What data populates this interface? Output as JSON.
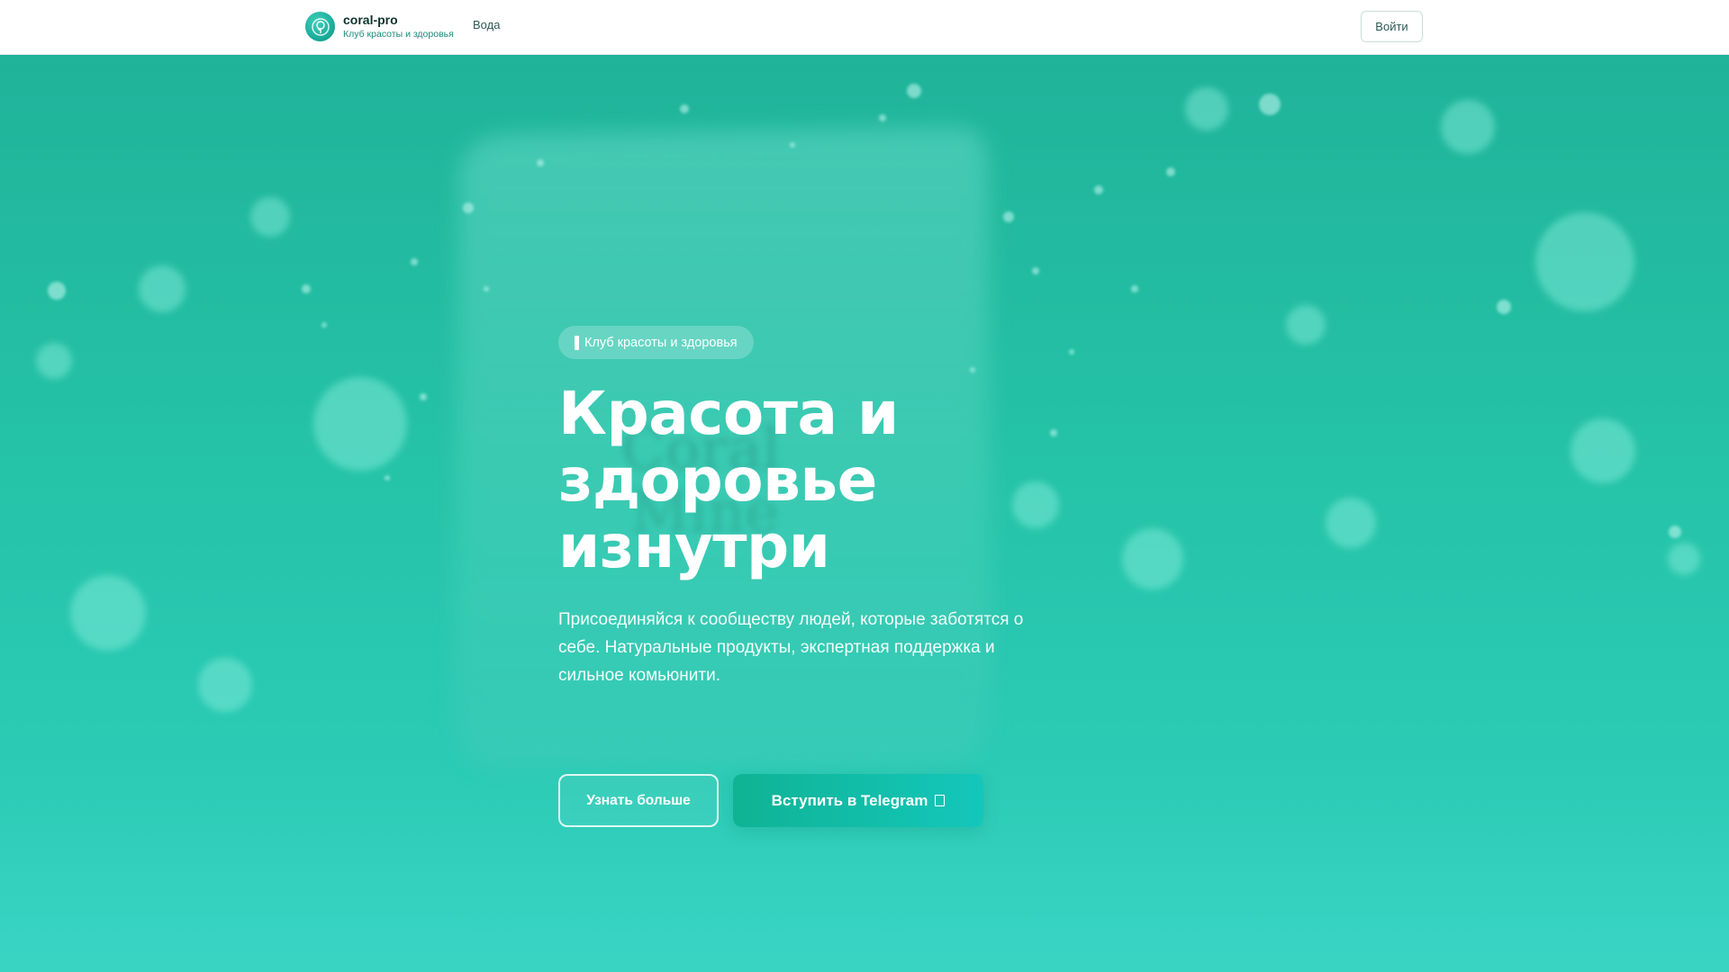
{
  "header": {
    "brand_name": "coral-pro",
    "brand_subtitle": "Клуб красоты и здоровья",
    "nav": [
      {
        "label": "Вода"
      }
    ],
    "login_label": "Войти"
  },
  "hero": {
    "badge": "Клуб красоты и здоровья",
    "title_lines": [
      "Красота и",
      "здоровье",
      "изнутри"
    ],
    "description": "Присоединяйся к сообществу людей, которые заботятся о себе. Натуральные продукты, экспертная поддержка и сильное комьюнити.",
    "buttons": {
      "learn_more": "Узнать больше",
      "join": "Вступить в Telegram"
    },
    "background_package_text": "Coral Mine"
  },
  "colors": {
    "accent": "#14c7bb",
    "hero_top": "#1fb39a",
    "hero_bottom": "#2fd0bd",
    "brand_subtitle": "#1e8a7a"
  },
  "icons": {
    "logo": "tree-leaf-icon",
    "telegram": "telegram-icon",
    "badge_marker": "bar-icon"
  }
}
